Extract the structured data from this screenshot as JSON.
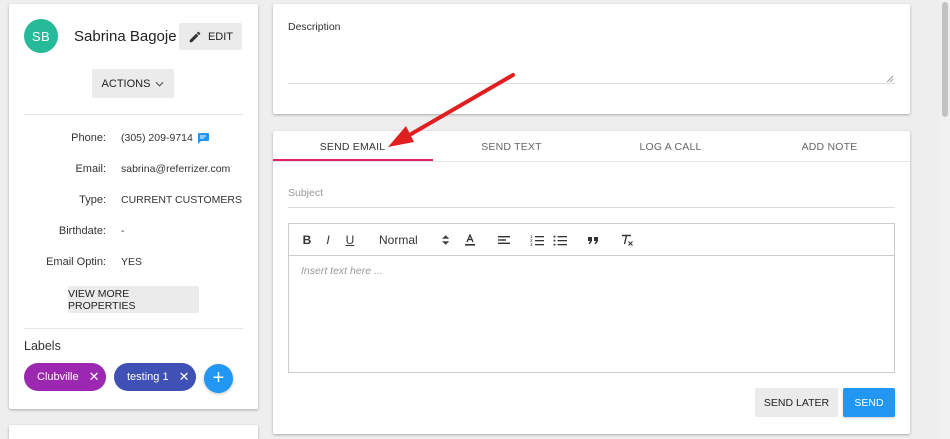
{
  "profile": {
    "initials": "SB",
    "name": "Sabrina Bagoje",
    "edit_label": "EDIT",
    "actions_label": "ACTIONS",
    "properties": [
      {
        "label": "Phone:",
        "value": "(305) 209-9714"
      },
      {
        "label": "Email:",
        "value": "sabrina@referrizer.com"
      },
      {
        "label": "Type:",
        "value": "CURRENT CUSTOMERS"
      },
      {
        "label": "Birthdate:",
        "value": "-"
      },
      {
        "label": "Email Optin:",
        "value": "YES"
      }
    ],
    "view_more_label": "VIEW MORE PROPERTIES",
    "labels_heading": "Labels",
    "labels": [
      {
        "text": "Clubville",
        "color": "#9c27b0"
      },
      {
        "text": "testing 1",
        "color": "#3f51b5"
      }
    ],
    "add_label_symbol": "+",
    "avatar_color": "#26b99a"
  },
  "description": {
    "label": "Description",
    "value": ""
  },
  "composer": {
    "tabs": [
      {
        "label": "SEND EMAIL",
        "active": true
      },
      {
        "label": "SEND TEXT",
        "active": false
      },
      {
        "label": "LOG A CALL",
        "active": false
      },
      {
        "label": "ADD NOTE",
        "active": false
      }
    ],
    "active_tab_color": "#e91e63",
    "subject_placeholder": "Subject",
    "toolbar": {
      "bold": "B",
      "italic": "I",
      "underline": "U",
      "size_select": "Normal",
      "icons": [
        "font-color-icon",
        "align-icon",
        "ordered-list-icon",
        "bullet-list-icon",
        "blockquote-icon",
        "clear-format-icon"
      ]
    },
    "editor_placeholder": "Insert text here ...",
    "send_later_label": "SEND LATER",
    "send_label": "SEND",
    "primary_color": "#2196f3"
  },
  "annotation": {
    "arrow_color": "#e02020"
  }
}
